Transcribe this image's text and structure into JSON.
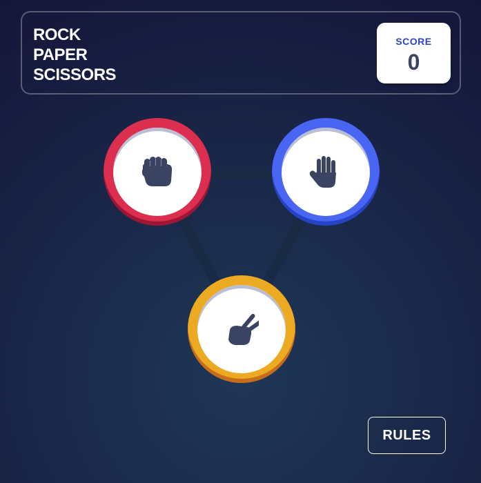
{
  "header": {
    "title_lines": [
      "ROCK",
      "PAPER",
      "SCISSORS"
    ],
    "score": {
      "label": "SCORE",
      "value": "0"
    }
  },
  "choices": [
    {
      "id": "rock",
      "icon": "rock-hand-icon",
      "ring_color": "#dc2e4e"
    },
    {
      "id": "paper",
      "icon": "paper-hand-icon",
      "ring_color": "#4865f4"
    },
    {
      "id": "scissors",
      "icon": "scissors-hand-icon",
      "ring_color": "#eca922"
    }
  ],
  "rules_button": {
    "label": "RULES"
  },
  "colors": {
    "background_center": "#1f3756",
    "background_edge": "#141539",
    "score_label": "#2a46c0",
    "score_value": "#3b4363",
    "icon": "#3b4363"
  }
}
